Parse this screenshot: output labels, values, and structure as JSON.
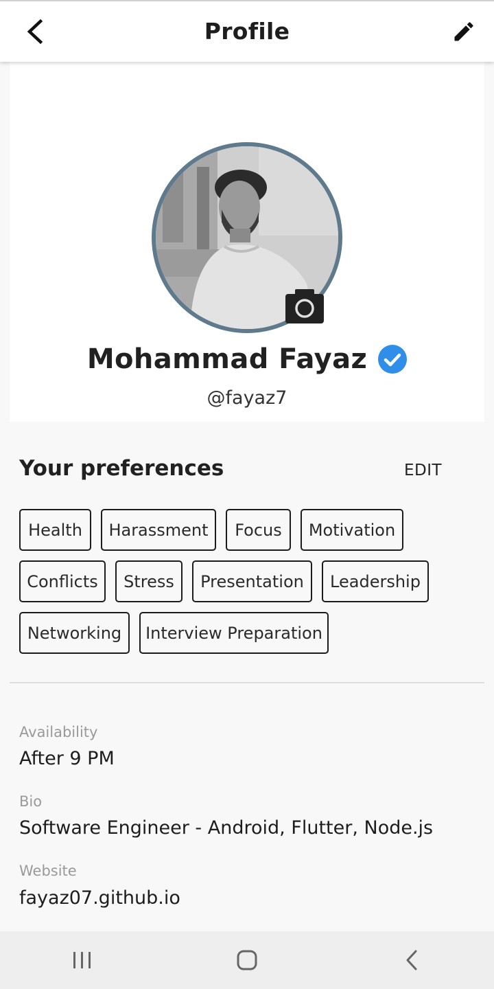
{
  "app_bar": {
    "title": "Profile",
    "back_icon": "arrow-back-icon",
    "edit_icon": "pencil-icon"
  },
  "profile": {
    "name": "Mohammad Fayaz",
    "handle": "@fayaz7",
    "verified": true,
    "camera_icon": "camera-icon",
    "ring_color": "#5e7a8c",
    "verified_color": "#2f8ee8"
  },
  "preferences": {
    "title": "Your preferences",
    "edit_label": "EDIT",
    "tags": [
      "Health",
      "Harassment",
      "Focus",
      "Motivation",
      "Conflicts",
      "Stress",
      "Presentation",
      "Leadership",
      "Networking",
      "Interview Preparation"
    ]
  },
  "info": {
    "availability": {
      "label": "Availability",
      "value": "After 9 PM"
    },
    "bio": {
      "label": "Bio",
      "value": "Software Engineer - Android, Flutter, Node.js"
    },
    "website": {
      "label": "Website",
      "value": "fayaz07.github.io"
    }
  },
  "system_nav": {
    "recents_icon": "recents-icon",
    "home_icon": "home-icon",
    "back_icon": "nav-back-icon"
  }
}
